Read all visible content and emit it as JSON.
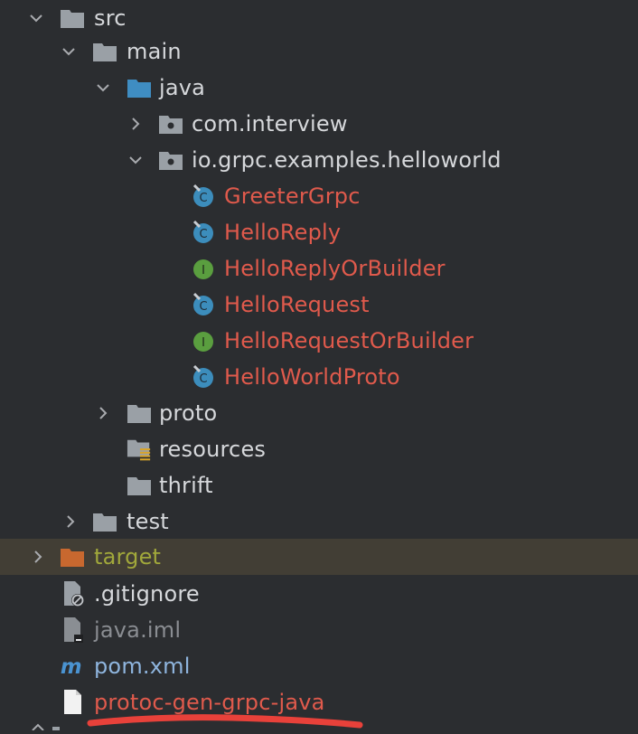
{
  "tree": [
    {
      "id": "src",
      "label": "src",
      "icon": "folder-icon",
      "expanded": true,
      "color": "default"
    },
    {
      "id": "main",
      "label": "main",
      "icon": "folder-icon",
      "expanded": true,
      "color": "default"
    },
    {
      "id": "java",
      "label": "java",
      "icon": "source-folder-icon",
      "expanded": true,
      "color": "default"
    },
    {
      "id": "com-interview",
      "label": "com.interview",
      "icon": "package-icon",
      "expanded": false,
      "color": "default"
    },
    {
      "id": "io-grpc",
      "label": "io.grpc.examples.helloworld",
      "icon": "package-icon",
      "expanded": true,
      "color": "default"
    },
    {
      "id": "greetergrpc",
      "label": "GreeterGrpc",
      "icon": "class-icon",
      "color": "red"
    },
    {
      "id": "helloreply",
      "label": "HelloReply",
      "icon": "class-icon",
      "color": "red"
    },
    {
      "id": "helloreplyorbuilder",
      "label": "HelloReplyOrBuilder",
      "icon": "interface-icon",
      "color": "red"
    },
    {
      "id": "hellorequest",
      "label": "HelloRequest",
      "icon": "class-icon",
      "color": "red"
    },
    {
      "id": "hellorequestorbuilder",
      "label": "HelloRequestOrBuilder",
      "icon": "interface-icon",
      "color": "red"
    },
    {
      "id": "helloworldproto",
      "label": "HelloWorldProto",
      "icon": "class-icon",
      "color": "red"
    },
    {
      "id": "proto",
      "label": "proto",
      "icon": "folder-icon",
      "expanded": false,
      "color": "default"
    },
    {
      "id": "resources",
      "label": "resources",
      "icon": "resources-folder-icon",
      "color": "default"
    },
    {
      "id": "thrift",
      "label": "thrift",
      "icon": "folder-icon",
      "color": "default"
    },
    {
      "id": "test",
      "label": "test",
      "icon": "folder-icon",
      "expanded": false,
      "color": "default"
    },
    {
      "id": "target",
      "label": "target",
      "icon": "excluded-folder-icon",
      "expanded": false,
      "color": "olive"
    },
    {
      "id": "gitignore",
      "label": ".gitignore",
      "icon": "ignore-file-icon",
      "color": "default"
    },
    {
      "id": "java-iml",
      "label": "java.iml",
      "icon": "iml-file-icon",
      "color": "grey"
    },
    {
      "id": "pom-xml",
      "label": "pom.xml",
      "icon": "maven-icon",
      "color": "default"
    },
    {
      "id": "protoc-gen",
      "label": "protoc-gen-grpc-java",
      "icon": "file-icon",
      "color": "red"
    }
  ],
  "colors": {
    "background": "#2b2d30",
    "highlight_row": "#423e35",
    "text": "#d6d8db",
    "red_text": "#e05a4c",
    "olive_text": "#a1a83b",
    "folder": "#9aa0a6",
    "source_folder": "#3f8dc2",
    "excluded_folder": "#c8682f",
    "class_icon": "#3c8dbc",
    "interface_icon": "#5a9e3f",
    "annotation_stroke": "#e8413a"
  }
}
